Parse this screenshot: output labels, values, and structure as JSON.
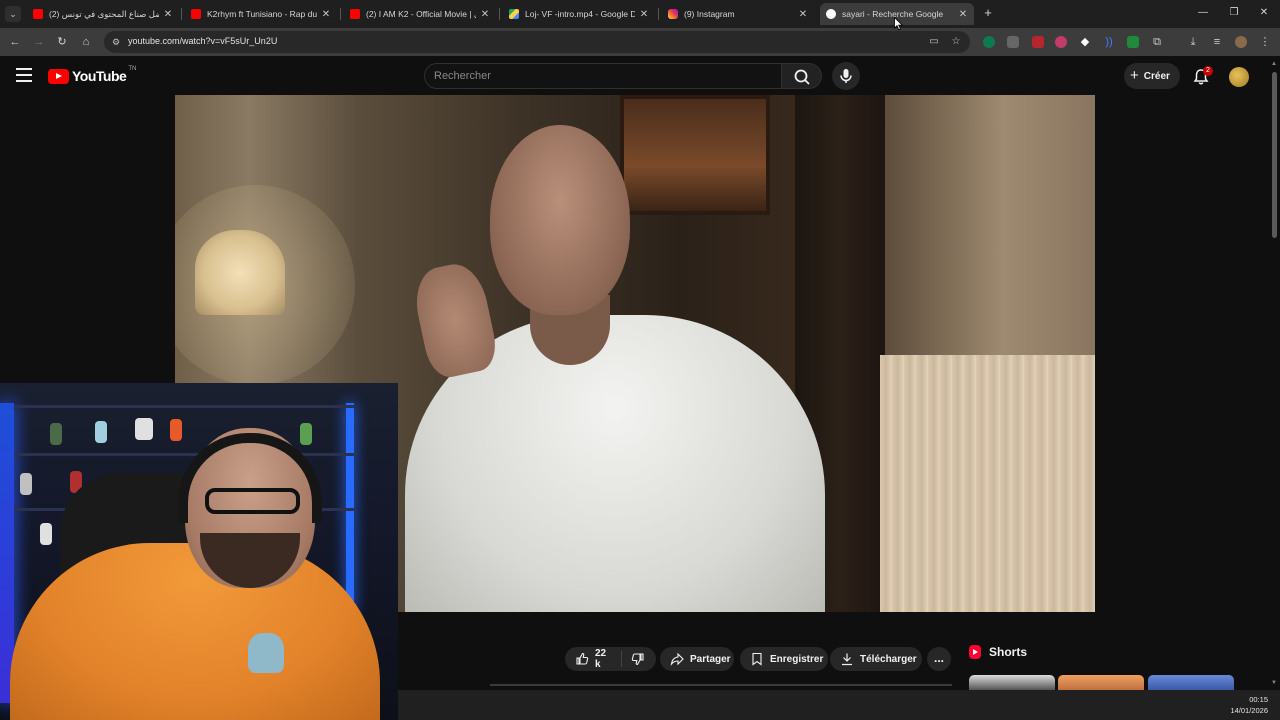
{
  "browser": {
    "tabs": [
      {
        "label": "(2) افضل صناع المحتوى في تونس",
        "favicon": "youtube-icon",
        "active": false
      },
      {
        "label": "K2rhym ft Tunisiano - Rap du b",
        "favicon": "youtube-icon",
        "active": false
      },
      {
        "label": "(2) I AM K2 - Official Movie | ي",
        "favicon": "youtube-icon",
        "active": false
      },
      {
        "label": "Loj- VF -intro.mp4 - Google Dr",
        "favicon": "google-drive-icon",
        "active": false
      },
      {
        "label": "(9) Instagram",
        "favicon": "instagram-icon",
        "active": false
      },
      {
        "label": "sayari - Recherche Google",
        "favicon": "google-icon",
        "active": true
      }
    ],
    "url": "youtube.com/watch?v=vF5sUr_Un2U"
  },
  "youtube": {
    "logo_text": "YouTube",
    "logo_region": "TN",
    "search_placeholder": "Rechercher",
    "create_label": "Créer",
    "notification_count": "2",
    "actions": {
      "likes": "22 k",
      "share": "Partager",
      "save": "Enregistrer",
      "download": "Télécharger",
      "more": "..."
    },
    "shorts_title": "Shorts"
  },
  "taskbar": {
    "time": "00:15",
    "date": "14/01/2026"
  },
  "colors": {
    "yt_red": "#ff0000",
    "background": "#0f0f0f",
    "pill": "#272727"
  }
}
